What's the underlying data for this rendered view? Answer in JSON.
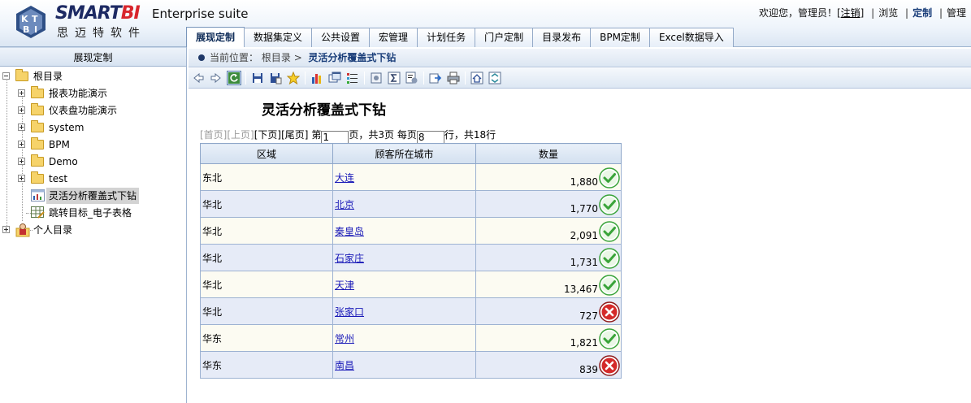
{
  "header": {
    "brand_part1": "SMART",
    "brand_part2": "BI",
    "brand_cn": "思迈特软件",
    "suite": "Enterprise suite",
    "welcome": "欢迎您，管理员！[",
    "logout": "注销",
    "welcome_end": "]",
    "link_browse": "浏览",
    "link_custom": "定制",
    "link_manage": "管理"
  },
  "tabs": [
    {
      "label": "展现定制",
      "active": true
    },
    {
      "label": "数据集定义"
    },
    {
      "label": "公共设置"
    },
    {
      "label": "宏管理"
    },
    {
      "label": "计划任务"
    },
    {
      "label": "门户定制"
    },
    {
      "label": "目录发布"
    },
    {
      "label": "BPM定制"
    },
    {
      "label": "Excel数据导入"
    }
  ],
  "left_panel": {
    "title": "展现定制",
    "tree": [
      {
        "label": "根目录"
      },
      {
        "label": "报表功能演示"
      },
      {
        "label": "仪表盘功能演示"
      },
      {
        "label": "system"
      },
      {
        "label": "BPM"
      },
      {
        "label": "Demo"
      },
      {
        "label": "test"
      },
      {
        "label": "灵活分析覆盖式下钻"
      },
      {
        "label": "跳转目标_电子表格"
      },
      {
        "label": "个人目录"
      }
    ]
  },
  "breadcrumb": {
    "prefix": "当前位置：",
    "root": "根目录",
    "arrow": ">",
    "current": "灵活分析覆盖式下钻"
  },
  "toolbar_icons": [
    "back-arrow-icon",
    "forward-arrow-icon",
    "refresh-icon",
    "save-icon",
    "save-as-icon",
    "favorite-star-icon",
    "chart-icon",
    "window-icon",
    "column-select-icon",
    "settings-icon",
    "sum-icon",
    "parameters-icon",
    "export-icon",
    "print-icon",
    "home-icon",
    "toggle-icon"
  ],
  "report": {
    "title": "灵活分析覆盖式下钻",
    "pager": {
      "first": "[首页]",
      "prev": "[上页]",
      "next": "[下页]",
      "last": "[尾页]",
      "page_prefix": "第",
      "page_value": "1",
      "page_suffix": "页，共3页",
      "per_prefix": "每页",
      "per_value": "8",
      "per_suffix": "行，共18行"
    },
    "columns": [
      "区域",
      "顾客所在城市",
      "数量"
    ],
    "rows": [
      {
        "region": "东北",
        "city": "大连",
        "qty": "1,880",
        "status": "ok"
      },
      {
        "region": "华北",
        "city": "北京",
        "qty": "1,770",
        "status": "ok"
      },
      {
        "region": "华北",
        "city": "秦皇岛",
        "qty": "2,091",
        "status": "ok"
      },
      {
        "region": "华北",
        "city": "石家庄",
        "qty": "1,731",
        "status": "ok"
      },
      {
        "region": "华北",
        "city": "天津",
        "qty": "13,467",
        "status": "ok"
      },
      {
        "region": "华北",
        "city": "张家口",
        "qty": "727",
        "status": "fail"
      },
      {
        "region": "华东",
        "city": "常州",
        "qty": "1,821",
        "status": "ok"
      },
      {
        "region": "华东",
        "city": "南昌",
        "qty": "839",
        "status": "fail"
      }
    ]
  },
  "colors": {
    "ok_green": "#3aa43a",
    "fail_red": "#c62020",
    "link_blue": "#1a1ab8",
    "brand_navy": "#1d2a63",
    "brand_red": "#d8262c"
  }
}
